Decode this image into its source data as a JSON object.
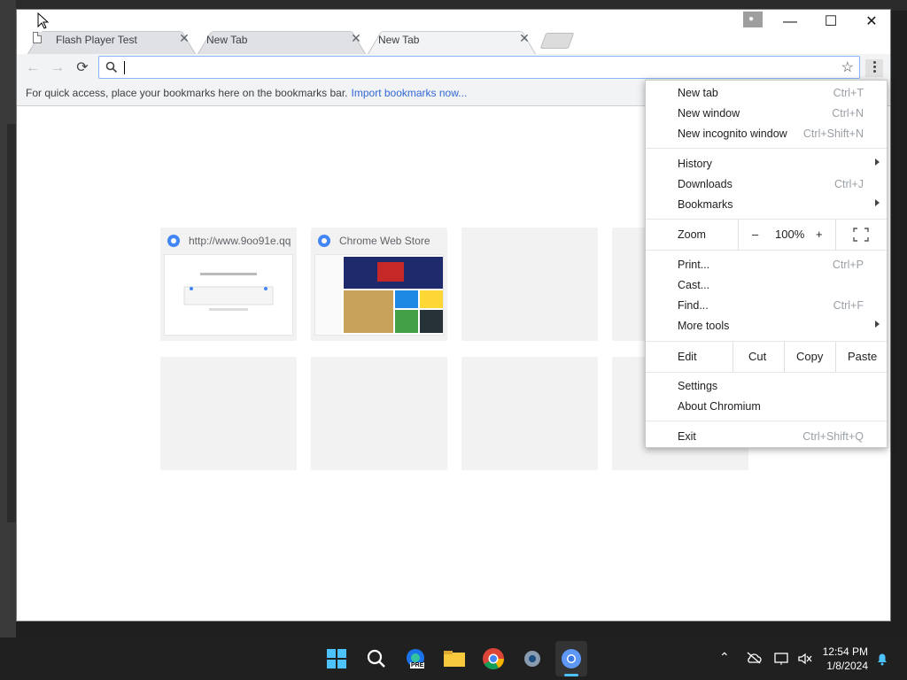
{
  "browser": {
    "tabs": [
      {
        "title": "Flash Player Test"
      },
      {
        "title": "New Tab"
      },
      {
        "title": "New Tab"
      }
    ]
  },
  "bookmarks_bar": {
    "hint": "For quick access, place your bookmarks here on the bookmarks bar.",
    "import_link": "Import bookmarks now..."
  },
  "tiles": [
    {
      "title": "http://www.9oo91e.qq"
    },
    {
      "title": "Chrome Web Store"
    }
  ],
  "menu": {
    "new_tab": {
      "label": "New tab",
      "shortcut": "Ctrl+T"
    },
    "new_window": {
      "label": "New window",
      "shortcut": "Ctrl+N"
    },
    "new_incognito": {
      "label": "New incognito window",
      "shortcut": "Ctrl+Shift+N"
    },
    "history": {
      "label": "History"
    },
    "downloads": {
      "label": "Downloads",
      "shortcut": "Ctrl+J"
    },
    "bookmarks": {
      "label": "Bookmarks"
    },
    "zoom": {
      "label": "Zoom",
      "minus": "–",
      "value": "100%",
      "plus": "+"
    },
    "print": {
      "label": "Print...",
      "shortcut": "Ctrl+P"
    },
    "cast": {
      "label": "Cast..."
    },
    "find": {
      "label": "Find...",
      "shortcut": "Ctrl+F"
    },
    "more_tools": {
      "label": "More tools"
    },
    "edit": {
      "label": "Edit",
      "cut": "Cut",
      "copy": "Copy",
      "paste": "Paste"
    },
    "settings": {
      "label": "Settings"
    },
    "about": {
      "label": "About Chromium"
    },
    "exit": {
      "label": "Exit",
      "shortcut": "Ctrl+Shift+Q"
    }
  },
  "taskbar": {
    "time": "12:54 PM",
    "date": "1/8/2024",
    "edge_badge": "PRE"
  }
}
